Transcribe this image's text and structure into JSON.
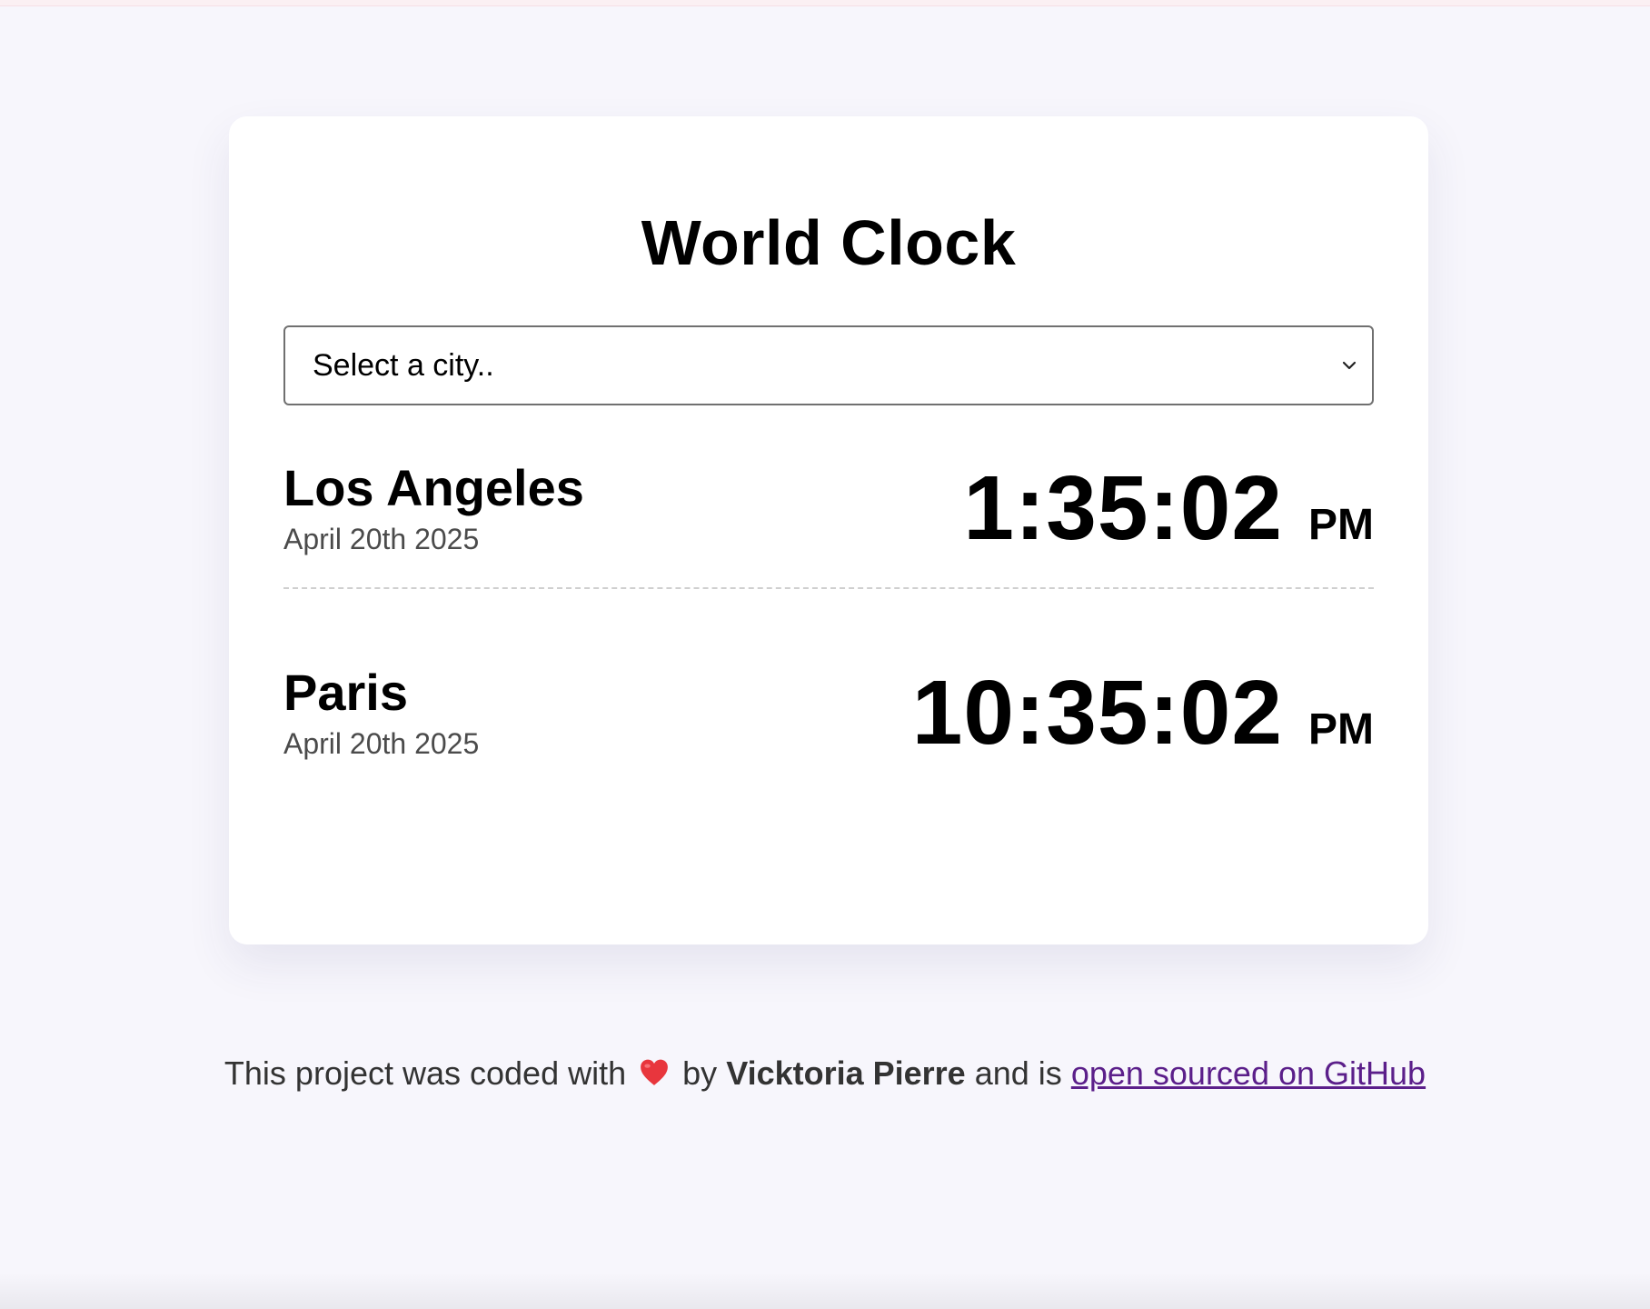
{
  "app": {
    "title": "World Clock"
  },
  "city_select": {
    "placeholder": "Select a city..",
    "icon": "chevron-down-icon"
  },
  "cities": [
    {
      "name": "Los Angeles",
      "date": "April 20th 2025",
      "time": "1:35:02",
      "ampm": "PM"
    },
    {
      "name": "Paris",
      "date": "April 20th 2025",
      "time": "10:35:02",
      "ampm": "PM"
    }
  ],
  "footer": {
    "prefix": "This project was coded with",
    "heart_icon": "heart-icon",
    "by": "by",
    "author": "Vicktoria Pierre",
    "middle": "and is",
    "link_text": "open sourced on GitHub"
  },
  "colors": {
    "background": "#f7f6fc",
    "card": "#ffffff",
    "link": "#5b1f8a",
    "date_text": "#4b4b4b"
  }
}
